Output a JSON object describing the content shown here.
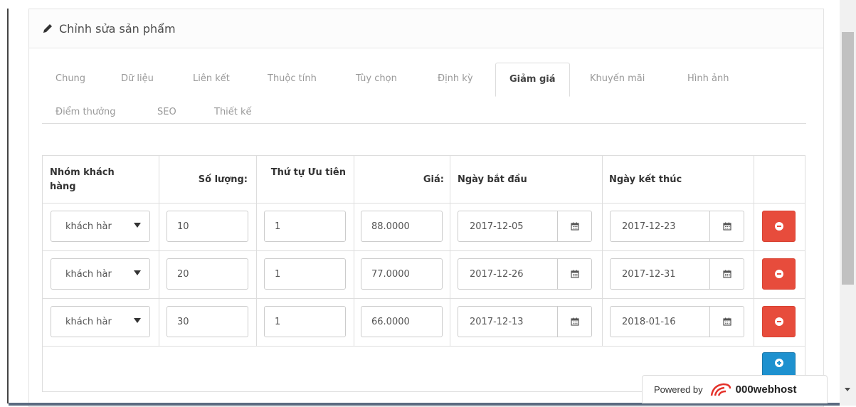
{
  "panel": {
    "title": "Chỉnh sửa sản phẩm",
    "icon": "pencil-icon"
  },
  "tabs": [
    {
      "label": "Chung",
      "active": false
    },
    {
      "label": "Dữ liệu",
      "active": false
    },
    {
      "label": "Liên kết",
      "active": false
    },
    {
      "label": "Thuộc tính",
      "active": false
    },
    {
      "label": "Tùy chọn",
      "active": false
    },
    {
      "label": "Định kỳ",
      "active": false
    },
    {
      "label": "Giảm giá",
      "active": true
    },
    {
      "label": "Khuyến mãi",
      "active": false
    },
    {
      "label": "Hình ảnh",
      "active": false
    },
    {
      "label": "Điểm thưởng",
      "active": false
    },
    {
      "label": "SEO",
      "active": false
    },
    {
      "label": "Thiết kế",
      "active": false
    }
  ],
  "table": {
    "headers": {
      "customer_group": "Nhóm khách hàng",
      "quantity": "Số lượng:",
      "priority": "Thứ tự Ưu tiên",
      "price": "Giá:",
      "date_start": "Ngày bắt đầu",
      "date_end": "Ngày kết thúc"
    },
    "rows": [
      {
        "customer_group": "khách hàr",
        "quantity": "10",
        "priority": "1",
        "price": "88.0000",
        "date_start": "2017-12-05",
        "date_end": "2017-12-23"
      },
      {
        "customer_group": "khách hàr",
        "quantity": "20",
        "priority": "1",
        "price": "77.0000",
        "date_start": "2017-12-26",
        "date_end": "2017-12-31"
      },
      {
        "customer_group": "khách hàr",
        "quantity": "30",
        "priority": "1",
        "price": "66.0000",
        "date_start": "2017-12-13",
        "date_end": "2018-01-16"
      }
    ]
  },
  "colors": {
    "remove_button": "#e74c3c",
    "add_button": "#1e91cf"
  },
  "badge": {
    "prefix": "Powered by",
    "brand": "000webhost"
  }
}
